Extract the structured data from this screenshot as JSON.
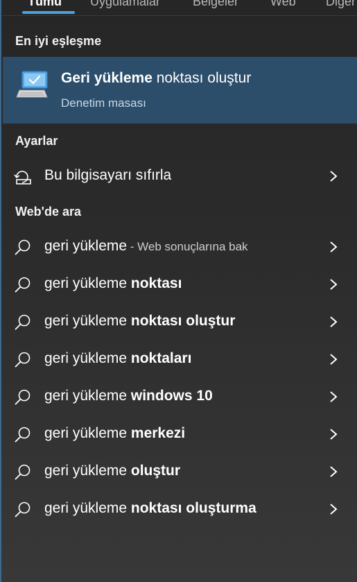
{
  "tabs": [
    "Tümü",
    "Uygulamalar",
    "Belgeler",
    "Web",
    "Diğer"
  ],
  "sections": {
    "best_match": "En iyi eşleşme",
    "settings": "Ayarlar",
    "web": "Web'de ara"
  },
  "best": {
    "title_bold": "Geri yükleme",
    "title_rest": " noktası oluştur",
    "subtitle": "Denetim masası",
    "icon": "computer-restore-icon"
  },
  "settings_items": [
    {
      "label": "Bu bilgisayarı sıfırla",
      "icon": "reset-pc-icon"
    }
  ],
  "web_items": [
    {
      "plain": "geri yükleme",
      "bold": "",
      "hint": " - Web sonuçlarına bak"
    },
    {
      "plain": "geri yükleme ",
      "bold": "noktası",
      "hint": ""
    },
    {
      "plain": "geri yükleme ",
      "bold": "noktası oluştur",
      "hint": ""
    },
    {
      "plain": "geri yükleme ",
      "bold": "noktaları",
      "hint": ""
    },
    {
      "plain": "geri yükleme ",
      "bold": "windows 10",
      "hint": ""
    },
    {
      "plain": "geri yükleme ",
      "bold": "merkezi",
      "hint": ""
    },
    {
      "plain": "geri yükleme ",
      "bold": "oluştur",
      "hint": ""
    },
    {
      "plain": "geri yükleme ",
      "bold": "noktası oluşturma",
      "hint": ""
    }
  ],
  "colors": {
    "accent": "#4aa3df",
    "selected_bg": "#2c4e6b"
  }
}
